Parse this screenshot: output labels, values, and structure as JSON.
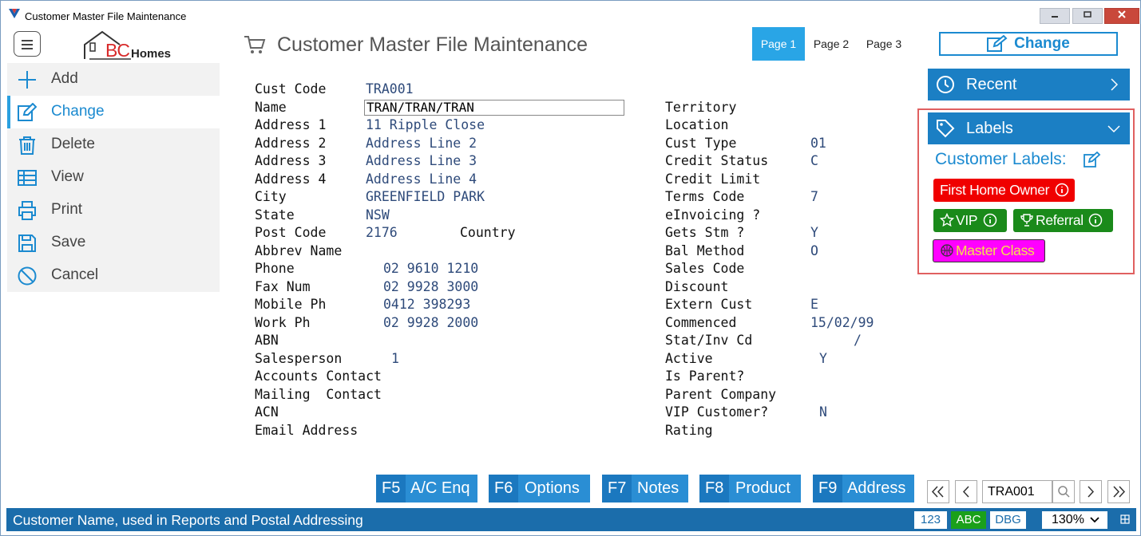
{
  "window": {
    "title": "Customer Master File Maintenance"
  },
  "header": {
    "logo_bc": "BC",
    "logo_homes": "Homes",
    "title": "Customer Master File Maintenance",
    "pages": [
      "Page 1",
      "Page 2",
      "Page 3"
    ],
    "active_page": "Page 1",
    "mode_label": "Change"
  },
  "sidebar": {
    "items": [
      {
        "label": "Add",
        "icon": "plus-icon"
      },
      {
        "label": "Change",
        "icon": "edit-icon",
        "active": true
      },
      {
        "label": "Delete",
        "icon": "trash-icon"
      },
      {
        "label": "View",
        "icon": "table-icon"
      },
      {
        "label": "Print",
        "icon": "printer-icon"
      },
      {
        "label": "Save",
        "icon": "floppy-icon"
      },
      {
        "label": "Cancel",
        "icon": "cancel-icon"
      }
    ]
  },
  "form": {
    "left_labels": [
      "Cust Code",
      "Name",
      "Address 1",
      "Address 2",
      "Address 3",
      "Address 4",
      "City",
      "State",
      "Post Code",
      "Abbrev Name",
      "Phone",
      "Fax Num",
      "Mobile Ph",
      "Work Ph",
      "ABN",
      "Salesperson",
      "Accounts Contact",
      "Mailing  Contact",
      "ACN",
      "Email Address"
    ],
    "cust_code": "TRA001",
    "name": "TRAN/TRAN/TRAN",
    "address1": "11 Ripple Close",
    "address2": "Address Line 2",
    "address3": "Address Line 3",
    "address4": "Address Line 4",
    "city": "GREENFIELD PARK",
    "state": "NSW",
    "post_code": "2176",
    "country_label": "Country",
    "phone": "02 9610 1210",
    "fax": "02 9928 3000",
    "mobile": "0412 398293",
    "work_ph": "02 9928 2000",
    "salesperson": "1",
    "right_labels": [
      "Territory",
      "Location",
      "Cust Type",
      "Credit Status",
      "Credit Limit",
      "Terms Code",
      "eInvoicing ?",
      "Gets Stm ?",
      "Bal Method",
      "Sales Code",
      "Discount",
      "Extern Cust",
      "Commenced",
      "Stat/Inv Cd",
      "Active",
      "Is Parent?",
      "Parent Company",
      "VIP Customer?",
      "Rating"
    ],
    "cust_type": "01",
    "credit_status": "C",
    "terms_code": "7",
    "gets_stm": "Y",
    "bal_method": "O",
    "extern_cust": "E",
    "commenced": "15/02/99",
    "stat_inv_cd": "/",
    "active": "Y",
    "vip_customer": "N"
  },
  "right_panel": {
    "recent_label": "Recent",
    "labels_label": "Labels",
    "customer_labels_title": "Customer Labels:",
    "tags": [
      {
        "text": "First Home Owner",
        "color": "#f00000"
      },
      {
        "text": "VIP",
        "color": "#1a8a1a"
      },
      {
        "text": "Referral",
        "color": "#1a8a1a"
      },
      {
        "text": "Master Class",
        "color": "#ff00ff"
      }
    ]
  },
  "function_keys": [
    {
      "key": "F5",
      "label": "A/C Enq"
    },
    {
      "key": "F6",
      "label": "Options"
    },
    {
      "key": "F7",
      "label": "Notes"
    },
    {
      "key": "F8",
      "label": "Product"
    },
    {
      "key": "F9",
      "label": "Address"
    }
  ],
  "navigator": {
    "value": "TRA001"
  },
  "status": {
    "text": "Customer Name, used in Reports and Postal Addressing",
    "badges": [
      "123",
      "ABC",
      "DBG"
    ],
    "zoom": "130%"
  },
  "colors": {
    "accent": "#1b8ad0",
    "panel": "#1b7fc4",
    "status": "#1b6dab"
  }
}
